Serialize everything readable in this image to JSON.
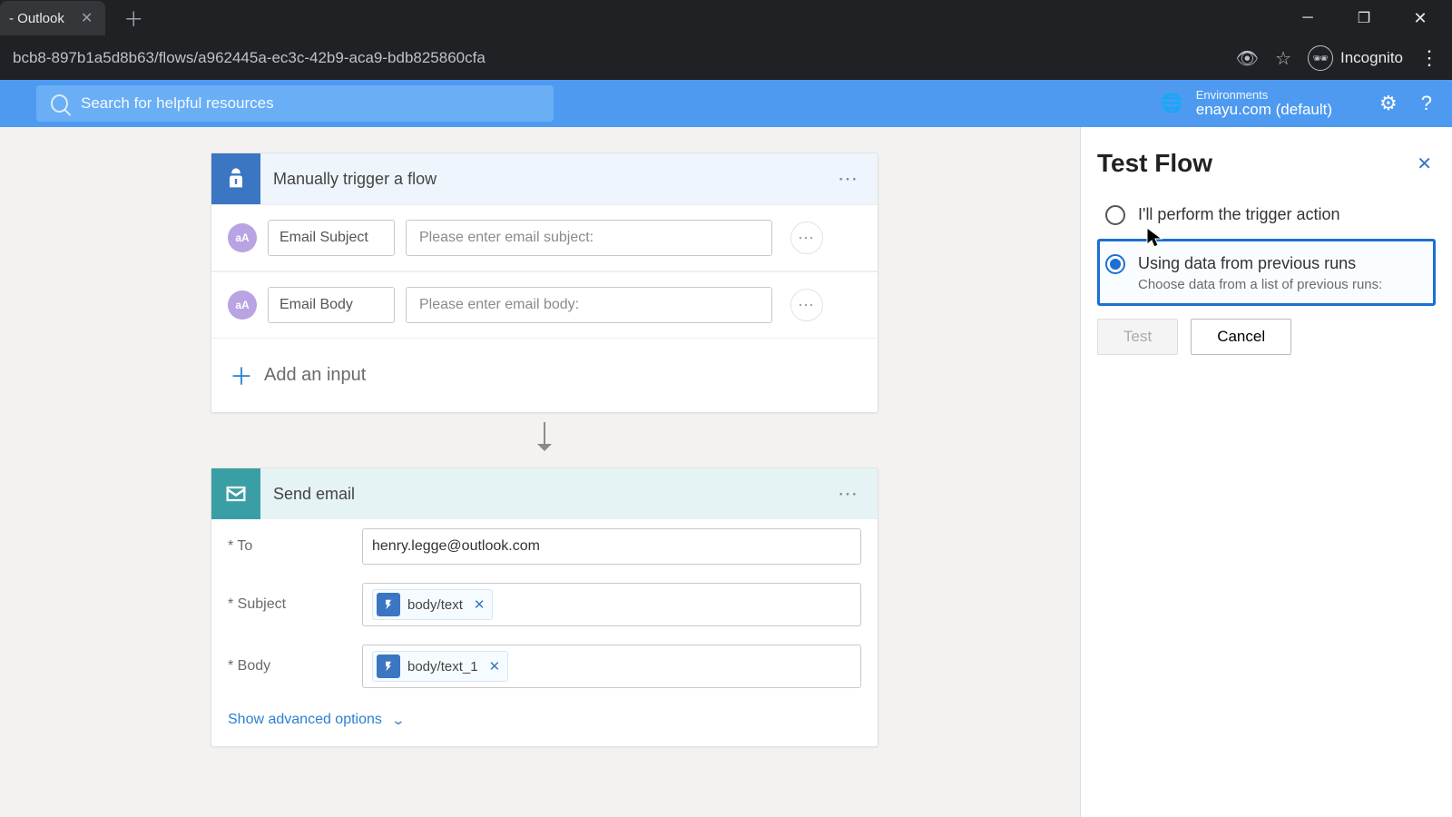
{
  "browser": {
    "tab_title": "- Outlook",
    "url_fragment": "bcb8-897b1a5d8b63/flows/a962445a-ec3c-42b9-aca9-bdb825860cfa",
    "incognito_label": "Incognito"
  },
  "header": {
    "search_placeholder": "Search for helpful resources",
    "env_label": "Environments",
    "env_value": "enayu.com (default)",
    "close_tooltip": "Close"
  },
  "trigger_card": {
    "title": "Manually trigger a flow",
    "params": [
      {
        "badge": "aA",
        "name": "Email Subject",
        "placeholder": "Please enter email subject:"
      },
      {
        "badge": "aA",
        "name": "Email Body",
        "placeholder": "Please enter email body:"
      }
    ],
    "add_input_label": "Add an input"
  },
  "action_card": {
    "title": "Send email",
    "rows": {
      "to": {
        "label": "* To",
        "value": "henry.legge@outlook.com"
      },
      "subject": {
        "label": "* Subject",
        "token": "body/text"
      },
      "body": {
        "label": "* Body",
        "token": "body/text_1"
      }
    },
    "advanced_label": "Show advanced options"
  },
  "panel": {
    "title": "Test Flow",
    "opt_manual": "I'll perform the trigger action",
    "opt_previous": "Using data from previous runs",
    "opt_previous_sub": "Choose data from a list of previous runs:",
    "btn_test": "Test",
    "btn_cancel": "Cancel"
  }
}
